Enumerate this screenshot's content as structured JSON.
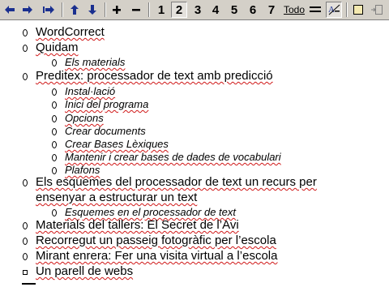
{
  "toolbar": {
    "levels": [
      "1",
      "2",
      "3",
      "4",
      "5",
      "6",
      "7"
    ],
    "active_level": "2",
    "todo_label": "Todo",
    "icons": [
      "arrow-left-icon",
      "arrow-right-icon",
      "arrow-right-double-icon",
      "arrow-up-icon",
      "arrow-down-icon",
      "plus-icon",
      "minus-icon",
      "lines-icon",
      "text-format-icon",
      "document-icon",
      "dock-icon"
    ]
  },
  "outline": {
    "items": [
      {
        "level": 1,
        "text": "WordCorrect"
      },
      {
        "level": 1,
        "text": "Quidam"
      },
      {
        "level": 2,
        "text": "Els materials"
      },
      {
        "level": 1,
        "text": "Preditex: processador de text amb predicció"
      },
      {
        "level": 2,
        "text": "Instal·lació"
      },
      {
        "level": 2,
        "text": "Inici del programa"
      },
      {
        "level": 2,
        "text": "Opcions"
      },
      {
        "level": 2,
        "text": "Crear documents"
      },
      {
        "level": 2,
        "text": "Crear Bases Lèxiques"
      },
      {
        "level": 2,
        "text": "Mantenir i crear bases de dades de vocabulari"
      },
      {
        "level": 2,
        "text": "Plafons"
      },
      {
        "level": 1,
        "text": "Els esquemes del processador de text un recurs per"
      },
      {
        "level": 1,
        "text": "ensenyar a estructurar un text"
      },
      {
        "level": 2,
        "text": "Esquemes en el processador de text"
      },
      {
        "level": 1,
        "text": "Materials del tallers: El Secret de l’Avi"
      },
      {
        "level": 1,
        "text": "Recorregut un passeig fotogràfic per l’escola"
      },
      {
        "level": 1,
        "text": "Mirant enrera: Fer una visita virtual a l’escola"
      },
      {
        "level": 1,
        "text": "Un parell de webs"
      }
    ]
  }
}
